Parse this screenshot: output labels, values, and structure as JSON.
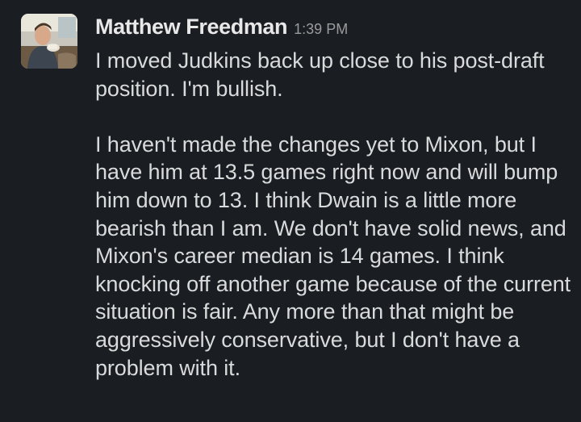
{
  "message": {
    "sender": "Matthew Freedman",
    "timestamp": "1:39 PM",
    "avatar_icon": "user-photo",
    "paragraphs": [
      "I moved Judkins back up close to his post-draft position. I'm bullish.",
      "I haven't made the changes yet to Mixon, but I have him at 13.5 games right now and will bump him down to 13. I think Dwain is a little more bearish than I am. We don't have solid news, and Mixon's career median is 14 games. I think knocking off another game because of the current situation is fair. Any more than that might be aggressively conservative, but I don't have a problem with it."
    ]
  },
  "colors": {
    "background": "#1a1d21",
    "sender": "#e8e8e8",
    "timestamp": "#9a9b9d",
    "text": "#d9dadb"
  }
}
